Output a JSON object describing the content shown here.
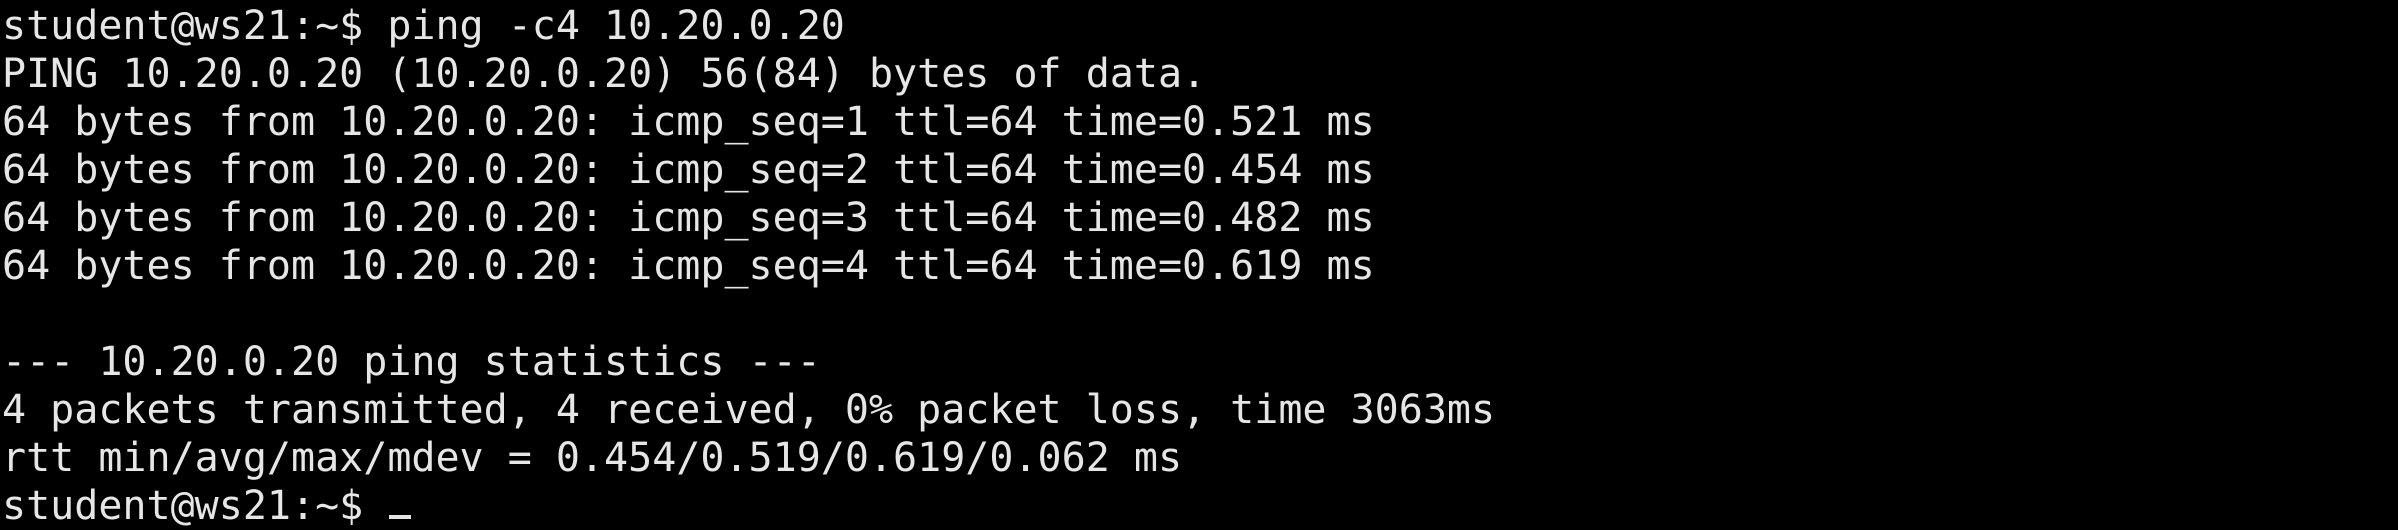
{
  "terminal": {
    "lines": [
      "student@ws21:~$ ping -c4 10.20.0.20",
      "PING 10.20.0.20 (10.20.0.20) 56(84) bytes of data.",
      "64 bytes from 10.20.0.20: icmp_seq=1 ttl=64 time=0.521 ms",
      "64 bytes from 10.20.0.20: icmp_seq=2 ttl=64 time=0.454 ms",
      "64 bytes from 10.20.0.20: icmp_seq=3 ttl=64 time=0.482 ms",
      "64 bytes from 10.20.0.20: icmp_seq=4 ttl=64 time=0.619 ms",
      "",
      "--- 10.20.0.20 ping statistics ---",
      "4 packets transmitted, 4 received, 0% packet loss, time 3063ms",
      "rtt min/avg/max/mdev = 0.454/0.519/0.619/0.062 ms"
    ],
    "prompt": "student@ws21:~$ ",
    "colors": {
      "background": "#000000",
      "foreground": "#e6e6e6"
    }
  }
}
